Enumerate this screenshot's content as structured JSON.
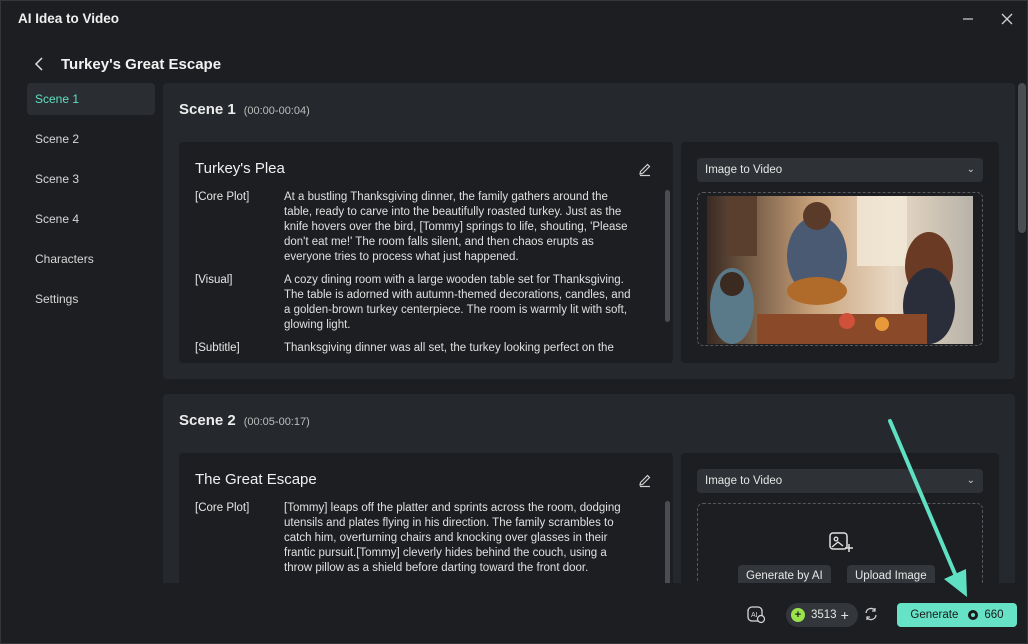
{
  "window": {
    "title": "AI Idea to Video"
  },
  "header": {
    "title": "Turkey's Great Escape"
  },
  "sidebar": {
    "items": [
      {
        "label": "Scene 1",
        "active": true
      },
      {
        "label": "Scene 2",
        "active": false
      },
      {
        "label": "Scene 3",
        "active": false
      },
      {
        "label": "Scene 4",
        "active": false
      },
      {
        "label": "Characters",
        "active": false
      },
      {
        "label": "Settings",
        "active": false
      }
    ]
  },
  "scenes": [
    {
      "name": "Scene 1",
      "time": "(00:00-00:04)",
      "card_title": "Turkey's Plea",
      "rows": [
        {
          "label": "[Core Plot]",
          "text": "At a bustling Thanksgiving dinner, the family gathers around the table, ready to carve into the beautifully roasted turkey. Just as the knife hovers over the bird, [Tommy] springs to life, shouting, 'Please don't eat me!' The room falls silent, and then chaos erupts as everyone tries to process what just happened."
        },
        {
          "label": "[Visual]",
          "text": "A cozy dining room with a large wooden table set for Thanksgiving. The table is adorned with autumn-themed decorations, candles, and a golden-brown turkey centerpiece. The room is warmly lit with soft, glowing light."
        },
        {
          "label": "[Subtitle]",
          "text": "Thanksgiving dinner was all set, the turkey looking perfect on the"
        }
      ],
      "mode": "Image to Video"
    },
    {
      "name": "Scene 2",
      "time": "(00:05-00:17)",
      "card_title": "The Great Escape",
      "rows": [
        {
          "label": "[Core Plot]",
          "text": "[Tommy] leaps off the platter and sprints across the room, dodging utensils and plates flying in his direction. The family scrambles to catch him, overturning chairs and knocking over glasses in their frantic pursuit.[Tommy] cleverly hides behind the couch, using a throw pillow as a shield before darting toward the front door."
        }
      ],
      "mode": "Image to Video",
      "generate_ai_label": "Generate by AI",
      "upload_label": "Upload Image"
    }
  ],
  "footer": {
    "credits": "3513",
    "generate_label": "Generate",
    "generate_cost": "660"
  },
  "colors": {
    "accent": "#66e2c6",
    "sidebar_active_text": "#5fe0c3",
    "arrow": "#5fe0c3"
  },
  "icons": [
    "minimize-icon",
    "close-icon",
    "back-chevron-icon",
    "edit-pencil-icon",
    "chevron-down-icon",
    "add-image-icon",
    "ai-assistant-icon",
    "credit-coin-icon",
    "refresh-icon"
  ]
}
